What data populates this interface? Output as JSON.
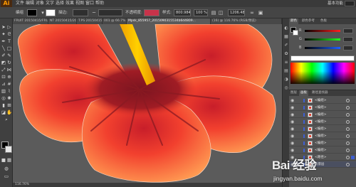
{
  "app": {
    "logo": "Ai",
    "workspace": "基本功能",
    "menus": [
      "文件",
      "编辑",
      "对象",
      "文字",
      "选择",
      "效果",
      "视图",
      "窗口",
      "帮助"
    ]
  },
  "control_bar": {
    "selection_label": "编组",
    "stroke_label": "描边:",
    "opacity_label": "不透明度:",
    "style_label": "样式:",
    "x_value": "800.984",
    "y_value": "100 %",
    "w_value": "1206.48"
  },
  "tabs": [
    {
      "label": "FRUIT 20150415/FRUIT2015"
    },
    {
      "label": "NT 20150415/2015"
    },
    {
      "label": "T.PS 20150415 ..."
    },
    {
      "label": "001 @ 66.7%"
    },
    {
      "label": "Mpsk_855957_2015090315534b6d4809..."
    },
    {
      "label": "(16) @ 116.76% (RGB/预览)"
    }
  ],
  "colors": {
    "accent_blue": "#3f5fd0",
    "petal_light": "#ff9a4a",
    "petal_dark": "#e8332c",
    "center_dark": "#8a1a22",
    "stem": "#f5b400"
  },
  "panel": {
    "tabs": [
      "颜色",
      "颜色参考",
      "色板"
    ],
    "sliders": [
      {
        "label": "R",
        "color": "#ff6060"
      },
      {
        "label": "G",
        "color": "#60ff60"
      },
      {
        "label": "B",
        "color": "#6090ff"
      }
    ]
  },
  "layers_panel": {
    "tabs": [
      "图层",
      "画板",
      "路径查找器"
    ],
    "rows": [
      {
        "name": "<编组>"
      },
      {
        "name": "<编组>"
      },
      {
        "name": "<编组>"
      },
      {
        "name": "<编组>"
      },
      {
        "name": "<编组>"
      },
      {
        "name": "<编组>"
      },
      {
        "name": "<编组>"
      },
      {
        "name": "<编组>"
      },
      {
        "name": "<路径>"
      },
      {
        "name": "背景层"
      }
    ]
  },
  "status": {
    "zoom": "116.76%"
  },
  "watermark": {
    "logo": "Bai 经验",
    "url": "jingyan.baidu.com"
  },
  "icons": [
    "selection-tool-icon",
    "direct-selection-icon",
    "magic-wand-icon",
    "lasso-icon",
    "pen-icon",
    "type-icon",
    "line-icon",
    "rectangle-icon",
    "paintbrush-icon",
    "pencil-icon",
    "eraser-icon",
    "rotate-icon",
    "scale-icon",
    "width-icon",
    "free-transform-icon",
    "shape-builder-icon",
    "perspective-icon",
    "mesh-icon",
    "gradient-icon",
    "eyedropper-icon",
    "blend-icon",
    "symbol-sprayer-icon",
    "column-graph-icon",
    "artboard-icon",
    "slice-icon",
    "hand-icon",
    "zoom-icon",
    "eye-icon"
  ]
}
